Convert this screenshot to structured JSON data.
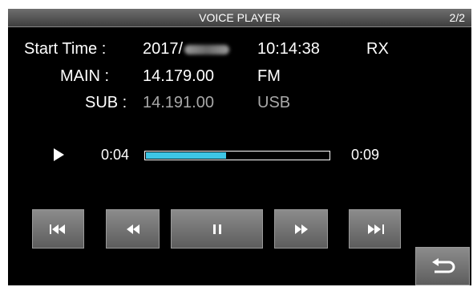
{
  "header": {
    "title": "VOICE PLAYER",
    "page": "2/2"
  },
  "info": {
    "start_time_label": "Start Time :",
    "date_prefix": "2017/",
    "time": "10:14:38",
    "mode_rx": "RX",
    "main_label": "MAIN :",
    "main_freq": "14.179.00",
    "main_mode": "FM",
    "sub_label": "SUB :",
    "sub_freq": "14.191.00",
    "sub_mode": "USB"
  },
  "playback": {
    "elapsed": "0:04",
    "total": "0:09",
    "progress_fraction": 0.444,
    "accent_color": "#3ec6e6"
  },
  "controls": {
    "icons": [
      "skip-previous-icon",
      "rewind-icon",
      "pause-icon",
      "fast-forward-icon",
      "skip-next-icon",
      "return-icon"
    ]
  }
}
